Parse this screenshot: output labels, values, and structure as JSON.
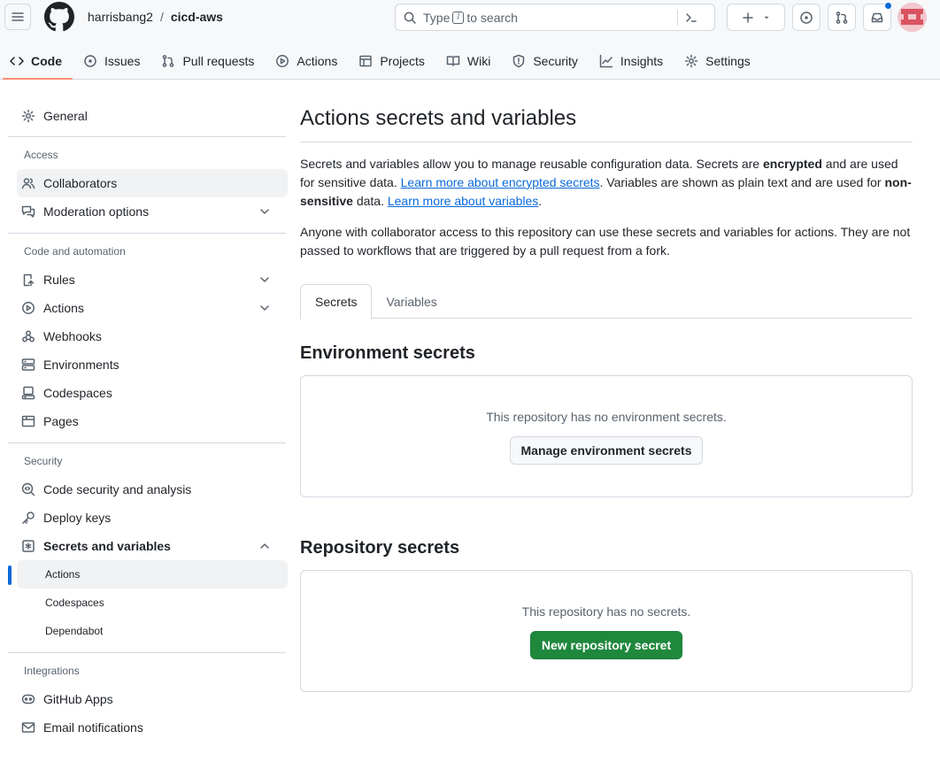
{
  "header": {
    "owner": "harrisbang2",
    "separator": "/",
    "repo": "cicd-aws",
    "search_prefix": "Type",
    "search_key": "/",
    "search_suffix": "to search"
  },
  "repo_tabs": [
    {
      "label": "Code",
      "icon": "code-icon"
    },
    {
      "label": "Issues",
      "icon": "issue-icon"
    },
    {
      "label": "Pull requests",
      "icon": "pull-request-icon"
    },
    {
      "label": "Actions",
      "icon": "play-icon"
    },
    {
      "label": "Projects",
      "icon": "table-icon"
    },
    {
      "label": "Wiki",
      "icon": "book-icon"
    },
    {
      "label": "Security",
      "icon": "shield-icon"
    },
    {
      "label": "Insights",
      "icon": "graph-icon"
    },
    {
      "label": "Settings",
      "icon": "gear-icon"
    }
  ],
  "sidebar": {
    "general": "General",
    "access_heading": "Access",
    "collaborators": "Collaborators",
    "moderation": "Moderation options",
    "code_auto_heading": "Code and automation",
    "rules": "Rules",
    "actions": "Actions",
    "webhooks": "Webhooks",
    "environments": "Environments",
    "codespaces": "Codespaces",
    "pages": "Pages",
    "security_heading": "Security",
    "code_security": "Code security and analysis",
    "deploy_keys": "Deploy keys",
    "secrets_vars": "Secrets and variables",
    "sub_actions": "Actions",
    "sub_codespaces": "Codespaces",
    "sub_dependabot": "Dependabot",
    "integrations_heading": "Integrations",
    "github_apps": "GitHub Apps",
    "email_notifications": "Email notifications"
  },
  "main": {
    "title": "Actions secrets and variables",
    "desc_p1": "Secrets and variables allow you to manage reusable configuration data. Secrets are ",
    "desc_bold1": "encrypted",
    "desc_p2": " and are used for sensitive data. ",
    "desc_link1": "Learn more about encrypted secrets",
    "desc_p3": ". Variables are shown as plain text and are used for ",
    "desc_bold2": "non-sensitive",
    "desc_p4": " data. ",
    "desc_link2": "Learn more about variables",
    "desc_p5": ".",
    "desc2": "Anyone with collaborator access to this repository can use these secrets and variables for actions. They are not passed to workflows that are triggered by a pull request from a fork.",
    "tab_secrets": "Secrets",
    "tab_variables": "Variables",
    "env_heading": "Environment secrets",
    "env_empty": "This repository has no environment secrets.",
    "env_button": "Manage environment secrets",
    "repo_heading": "Repository secrets",
    "repo_empty": "This repository has no secrets.",
    "repo_button": "New repository secret"
  },
  "colors": {
    "accent": "#0969da",
    "tab_underline": "#fd8c73",
    "primary_button": "#1f883d"
  }
}
